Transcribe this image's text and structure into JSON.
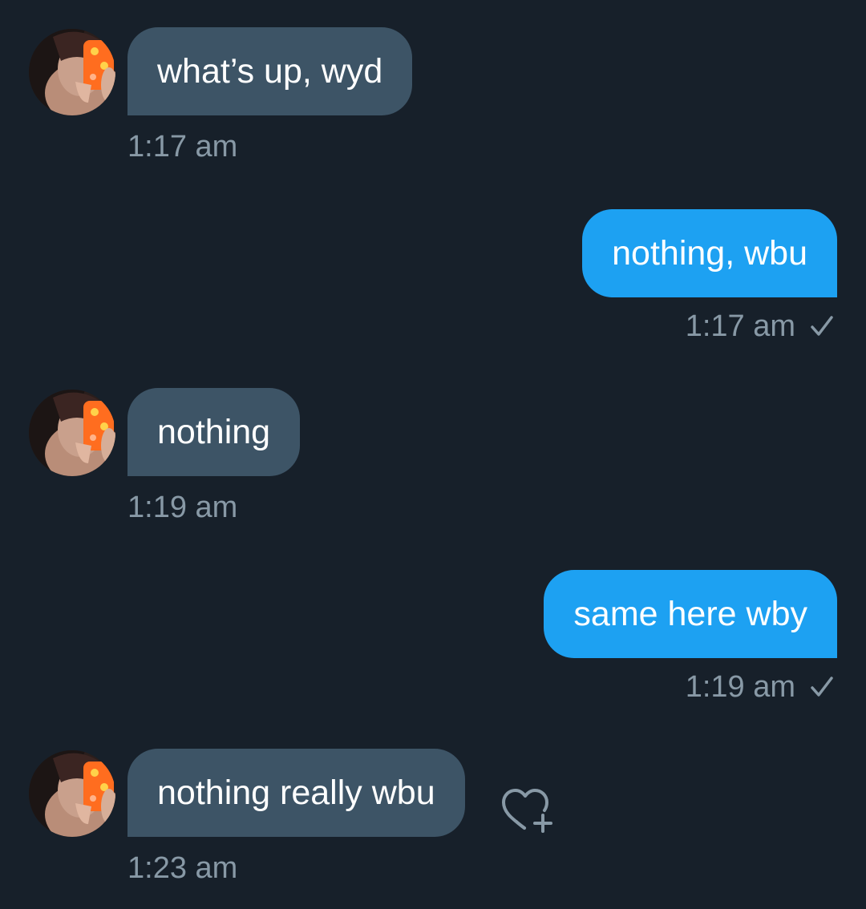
{
  "colors": {
    "background": "#17202a",
    "incoming_bubble": "#3d5466",
    "outgoing_bubble": "#1da1f2",
    "timestamp": "#8899a6",
    "text": "#ffffff"
  },
  "messages": [
    {
      "direction": "incoming",
      "text": "what’s up, wyd",
      "time": "1:17 am",
      "avatar": "avatar-photo"
    },
    {
      "direction": "outgoing",
      "text": "nothing, wbu",
      "time": "1:17 am",
      "status_icon": "check-icon"
    },
    {
      "direction": "incoming",
      "text": "nothing",
      "time": "1:19 am",
      "avatar": "avatar-photo"
    },
    {
      "direction": "outgoing",
      "text": "same here wby",
      "time": "1:19 am",
      "status_icon": "check-icon"
    },
    {
      "direction": "incoming",
      "text": "nothing really wbu",
      "time": "1:23 am",
      "avatar": "avatar-photo",
      "reaction_icon": "heart-plus-icon"
    }
  ]
}
